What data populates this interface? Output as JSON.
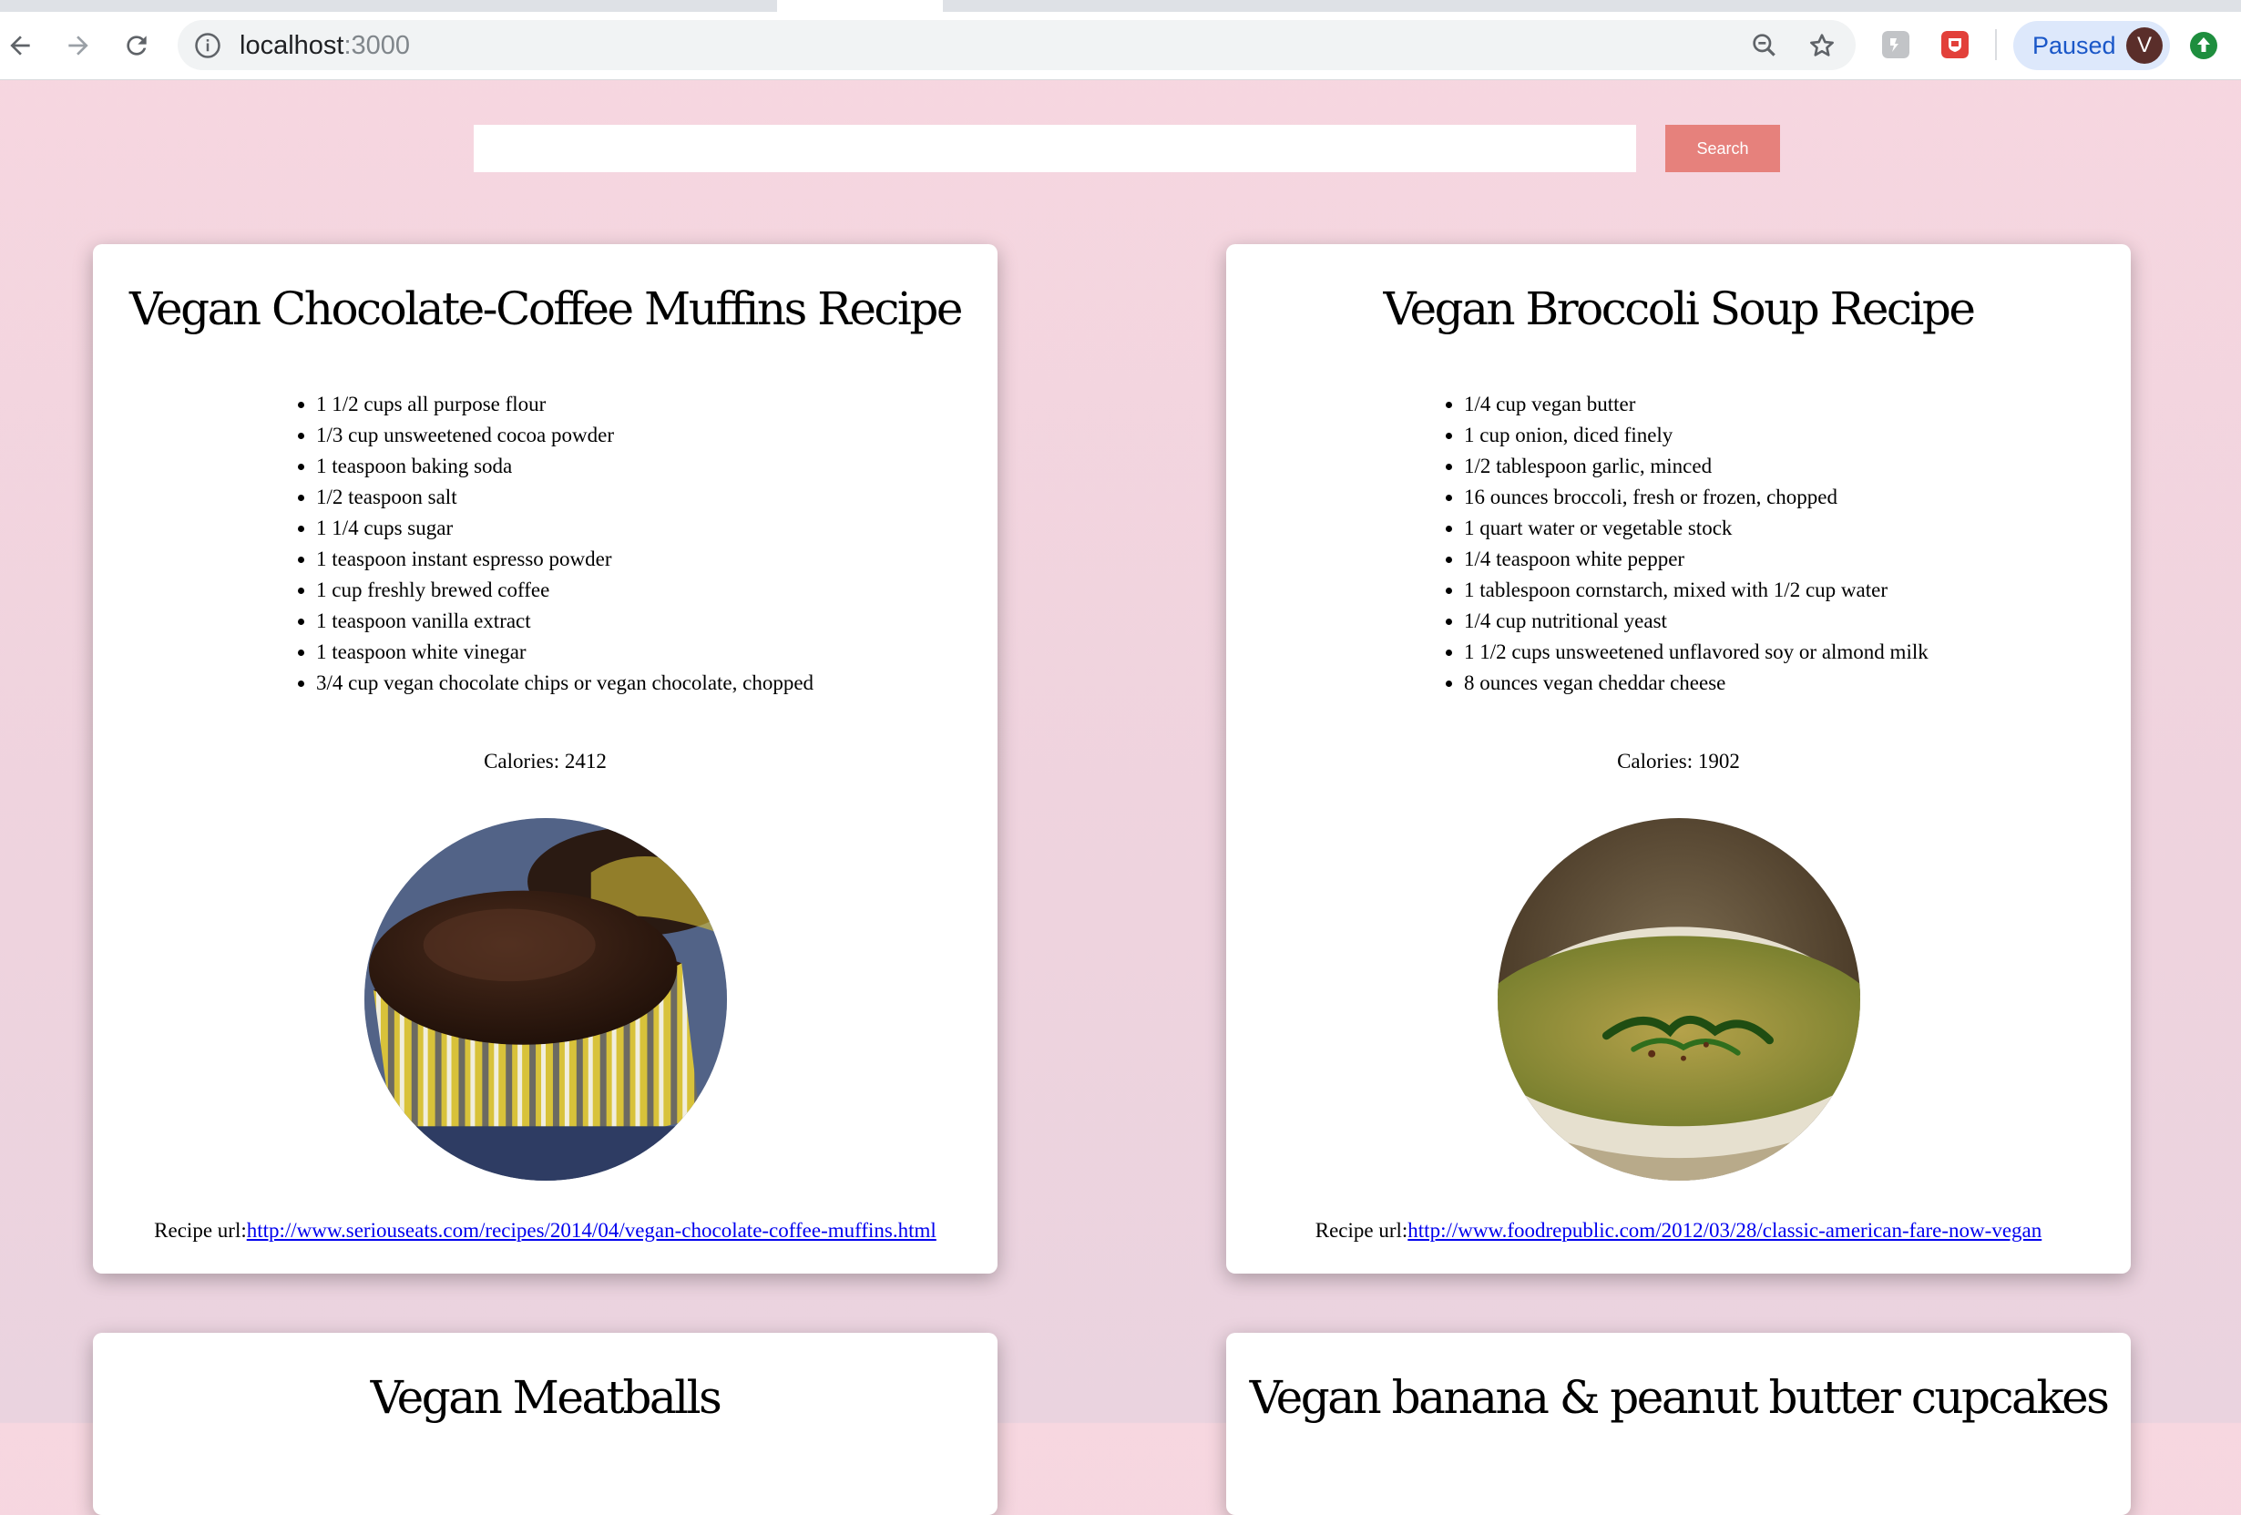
{
  "browser": {
    "url_host": "localhost",
    "url_port": ":3000",
    "profile_status": "Paused",
    "avatar_initial": "V"
  },
  "search": {
    "value": "",
    "placeholder": "",
    "button_label": "Search"
  },
  "recipes": [
    {
      "title": "Vegan Chocolate-Coffee Muffins Recipe",
      "ingredients": [
        "1 1/2 cups all purpose flour",
        "1/3 cup unsweetened cocoa powder",
        "1 teaspoon baking soda",
        "1/2 teaspoon salt",
        "1 1/4 cups sugar",
        "1 teaspoon instant espresso powder",
        "1 cup freshly brewed coffee",
        "1 teaspoon vanilla extract",
        "1 teaspoon white vinegar",
        "3/4 cup vegan chocolate chips or vegan chocolate, chopped"
      ],
      "calories": "Calories: 2412",
      "url_label": "Recipe url:",
      "url": "http://www.seriouseats.com/recipes/2014/04/vegan-chocolate-coffee-muffins.html",
      "image": "chocolate-muffin-photo"
    },
    {
      "title": "Vegan Broccoli Soup Recipe",
      "ingredients": [
        "1/4 cup vegan butter",
        "1 cup onion, diced finely",
        "1/2 tablespoon garlic, minced",
        "16 ounces broccoli, fresh or frozen, chopped",
        "1 quart water or vegetable stock",
        "1/4 teaspoon white pepper",
        "1 tablespoon cornstarch, mixed with 1/2 cup water",
        "1/4 cup nutritional yeast",
        "1 1/2 cups unsweetened unflavored soy or almond milk",
        "8 ounces vegan cheddar cheese"
      ],
      "calories": "Calories: 1902",
      "url_label": "Recipe url:",
      "url": "http://www.foodrepublic.com/2012/03/28/classic-american-fare-now-vegan",
      "image": "broccoli-soup-photo"
    },
    {
      "title": "Vegan Meatballs"
    },
    {
      "title": "Vegan banana & peanut butter cupcakes"
    }
  ],
  "colors": {
    "page_background": "#f7d7e0",
    "search_button": "#e6817c",
    "link": "#0000ee",
    "profile_pill": "#dde8fb",
    "profile_text": "#1a57c8"
  },
  "icons": {
    "back": "back-arrow-icon",
    "forward": "forward-arrow-icon",
    "reload": "reload-icon",
    "site_info": "info-icon",
    "zoom": "zoom-out-icon",
    "bookmark": "star-icon",
    "extension_1": "extension-icon",
    "extension_2": "shield-extension-icon",
    "update": "update-arrow-icon"
  }
}
